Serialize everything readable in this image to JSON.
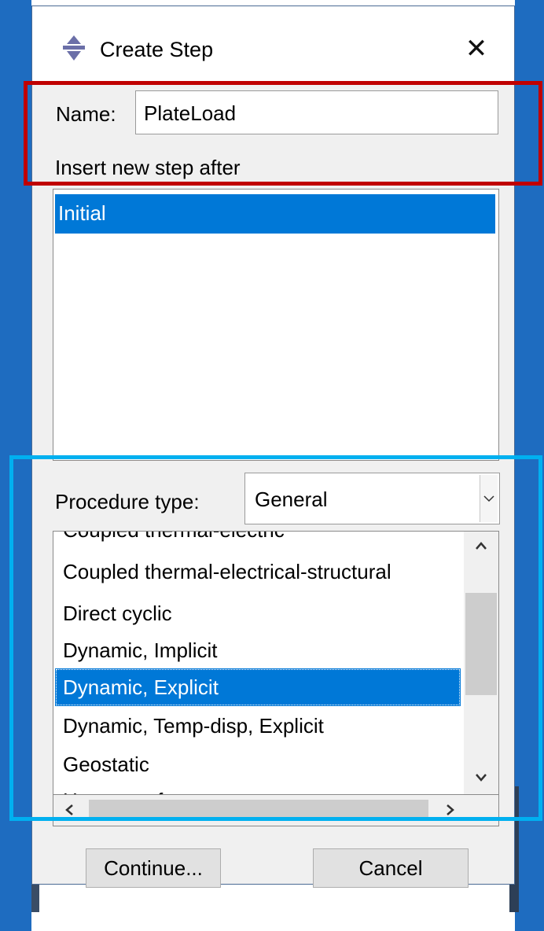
{
  "dialog": {
    "title": "Create Step",
    "close_glyph": "✕",
    "name_label": "Name:",
    "name_value": "PlateLoad",
    "insert_label": "Insert new step after",
    "steps": [
      "Initial"
    ],
    "procedure_label": "Procedure type:",
    "procedure_value": "General",
    "procedure_items": [
      "Coupled thermal-electric",
      "Coupled thermal-electrical-structural",
      "Direct cyclic",
      "Dynamic, Implicit",
      "Dynamic, Explicit",
      "Dynamic, Temp-disp, Explicit",
      "Geostatic",
      "Heat transfer"
    ],
    "selected_procedure": "Dynamic, Explicit",
    "continue_label": "Continue...",
    "cancel_label": "Cancel"
  },
  "icons": {
    "title_icon": "abaqus-step-icon",
    "close": "close-icon",
    "dropdown": "chevron-down-icon",
    "scroll_up": "chevron-up-icon",
    "scroll_down": "chevron-down-icon",
    "scroll_left": "chevron-left-icon",
    "scroll_right": "chevron-right-icon"
  },
  "colors": {
    "selection": "#0078d7",
    "highlight_red": "#c00000",
    "highlight_blue": "#00b0f0",
    "desktop": "#1e6cc0"
  }
}
